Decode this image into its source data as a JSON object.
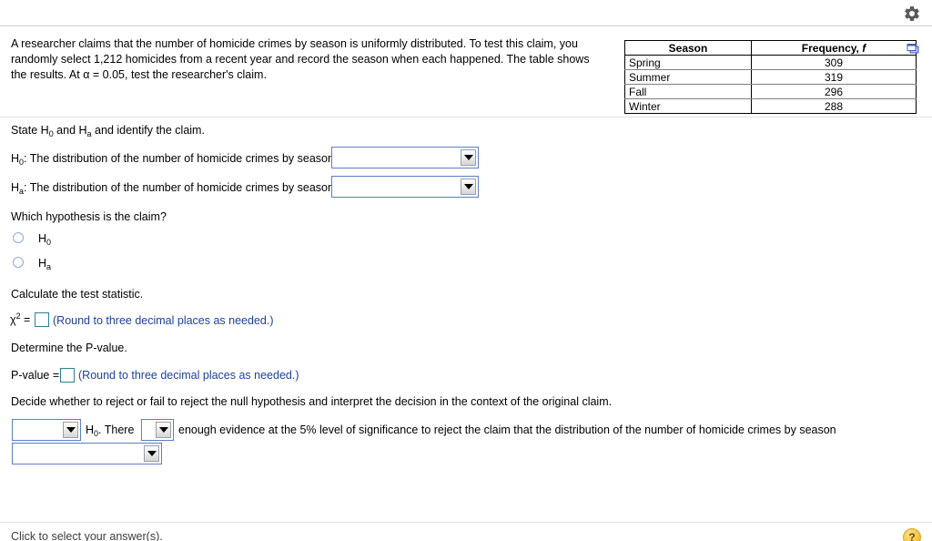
{
  "topbar": {
    "gear_icon": "gear-icon"
  },
  "prompt": {
    "text": "A researcher claims that the number of homicide crimes by season is uniformly distributed. To test this claim, you randomly select 1,212 homicides from a recent year and record the season when each happened. The table shows the results. At α = 0.05, test the researcher's claim."
  },
  "table": {
    "headers": [
      "Season",
      "Frequency, f"
    ],
    "rows": [
      {
        "season": "Spring",
        "frequency": "309"
      },
      {
        "season": "Summer",
        "frequency": "319"
      },
      {
        "season": "Fall",
        "frequency": "296"
      },
      {
        "season": "Winter",
        "frequency": "288"
      }
    ],
    "copy_icon": "copy-icon"
  },
  "sections": {
    "state_hypotheses": "State H0 and Ha and identify the claim.",
    "state_hypotheses_pre": "State H",
    "state_hypotheses_sub1": "0",
    "state_hypotheses_mid": " and H",
    "state_hypotheses_sub2": "a",
    "state_hypotheses_post": " and identify the claim.",
    "h0_label_pre": "H",
    "h0_label_sub": "0",
    "h0_label_post": ": The distribution of the number of homicide crimes by season",
    "ha_label_pre": "H",
    "ha_label_sub": "a",
    "ha_label_post": ": The distribution of the number of homicide crimes by season",
    "which_claim": "Which hypothesis is the claim?",
    "radio_h0_pre": "H",
    "radio_h0_sub": "0",
    "radio_ha_pre": "H",
    "radio_ha_sub": "a",
    "calc_test_statistic": "Calculate the test statistic.",
    "chi_symbol": "χ",
    "chi_exponent": "2",
    "chi_equals": " = ",
    "chi_hint": "(Round to three decimal places as needed.)",
    "determine_pvalue": "Determine the P-value.",
    "pvalue_label": "P-value = ",
    "pvalue_hint": "(Round to three decimal places as needed.)",
    "decide_text": "Decide whether to reject or fail to reject the null hypothesis and interpret the decision in the context of the original claim.",
    "decision_mid_pre": "H",
    "decision_mid_sub": "0",
    "decision_mid_post": ". There",
    "decision_tail": "enough evidence at the 5% level of significance to reject the claim that the distribution of the number of homicide crimes by season"
  },
  "dropdowns": {
    "h0_value": "",
    "ha_value": "",
    "decision_value": "",
    "evidence_value": "",
    "conclusion_value": ""
  },
  "inputs": {
    "chi_square_value": "",
    "pvalue_value": ""
  },
  "footer": {
    "instruction": "Click to select your answer(s).",
    "help_label": "?"
  },
  "colors": {
    "dropdown_border": "#5a7fc4",
    "input_border": "#2f7f93",
    "hint_text": "#20429c",
    "radio_border": "#8ea8dd",
    "help_button": "#f5c542",
    "copy_icon": "#3f62b5"
  }
}
